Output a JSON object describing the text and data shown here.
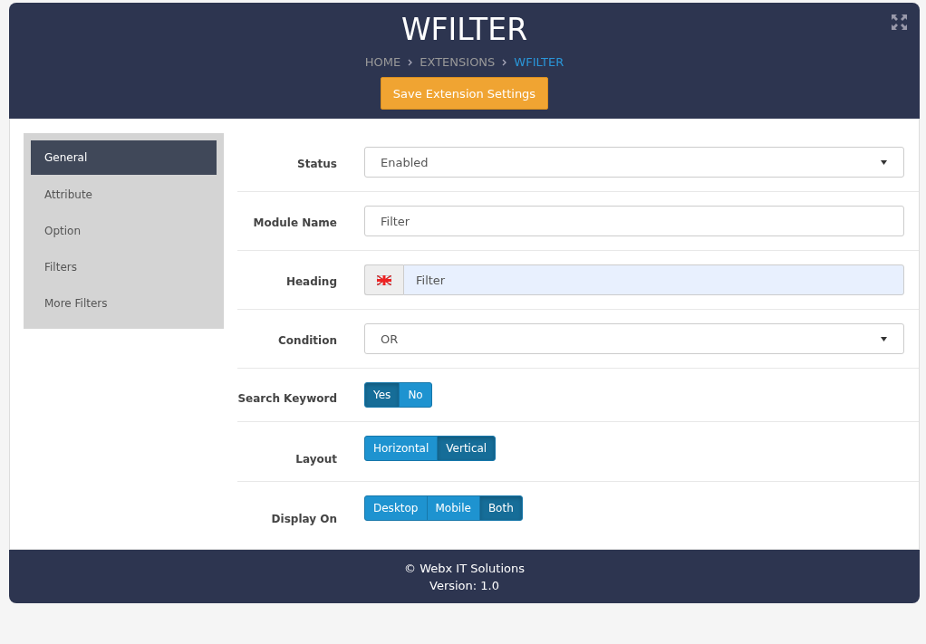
{
  "header": {
    "title": "WFILTER",
    "breadcrumb": [
      {
        "label": "HOME",
        "current": false
      },
      {
        "label": "EXTENSIONS",
        "current": false
      },
      {
        "label": "WFILTER",
        "current": true
      }
    ],
    "save_button": "Save Extension Settings"
  },
  "sidebar": {
    "items": [
      {
        "label": "General",
        "selected": true
      },
      {
        "label": "Attribute",
        "selected": false
      },
      {
        "label": "Option",
        "selected": false
      },
      {
        "label": "Filters",
        "selected": false
      },
      {
        "label": "More Filters",
        "selected": false
      }
    ]
  },
  "fields": [
    {
      "kind": "select",
      "label": "Status",
      "value": "Enabled"
    },
    {
      "kind": "text",
      "label": "Module Name",
      "value": "Filter"
    },
    {
      "kind": "lang-text",
      "label": "Heading",
      "value": "Filter"
    },
    {
      "kind": "select",
      "label": "Condition",
      "value": "OR"
    },
    {
      "kind": "toggle",
      "label": "Search Keyword",
      "options": [
        {
          "label": "Yes",
          "selected": true
        },
        {
          "label": "No",
          "selected": false
        }
      ]
    },
    {
      "kind": "toggle",
      "label": "Layout",
      "options": [
        {
          "label": "Horizontal",
          "selected": false
        },
        {
          "label": "Vertical",
          "selected": true
        }
      ]
    },
    {
      "kind": "toggle",
      "label": "Display On",
      "options": [
        {
          "label": "Desktop",
          "selected": false
        },
        {
          "label": "Mobile",
          "selected": false
        },
        {
          "label": "Both",
          "selected": true
        }
      ]
    }
  ],
  "footer": {
    "copyright": "© Webx IT Solutions",
    "version": "Version: 1.0"
  }
}
